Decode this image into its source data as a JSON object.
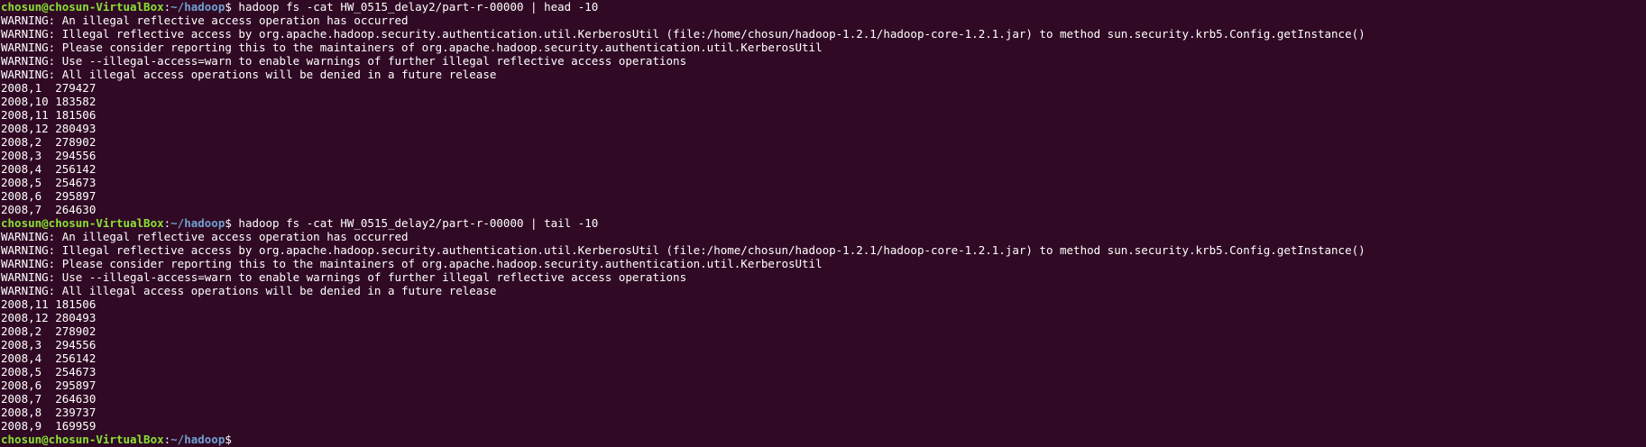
{
  "colors": {
    "background": "#300a24",
    "text": "#ffffff",
    "prompt_user": "#8ae234",
    "prompt_path": "#729fcf"
  },
  "prompt": {
    "user_host": "chosun@chosun-VirtualBox",
    "separator": ":",
    "path": "~/hadoop",
    "symbol": "$"
  },
  "blocks": [
    {
      "command": " hadoop fs -cat HW_0515_delay2/part-r-00000 | head -10",
      "output": [
        "WARNING: An illegal reflective access operation has occurred",
        "WARNING: Illegal reflective access by org.apache.hadoop.security.authentication.util.KerberosUtil (file:/home/chosun/hadoop-1.2.1/hadoop-core-1.2.1.jar) to method sun.security.krb5.Config.getInstance()",
        "WARNING: Please consider reporting this to the maintainers of org.apache.hadoop.security.authentication.util.KerberosUtil",
        "WARNING: Use --illegal-access=warn to enable warnings of further illegal reflective access operations",
        "WARNING: All illegal access operations will be denied in a future release",
        "2008,1  279427",
        "2008,10 183582",
        "2008,11 181506",
        "2008,12 280493",
        "2008,2  278902",
        "2008,3  294556",
        "2008,4  256142",
        "2008,5  254673",
        "2008,6  295897",
        "2008,7  264630"
      ]
    },
    {
      "command": " hadoop fs -cat HW_0515_delay2/part-r-00000 | tail -10",
      "output": [
        "WARNING: An illegal reflective access operation has occurred",
        "WARNING: Illegal reflective access by org.apache.hadoop.security.authentication.util.KerberosUtil (file:/home/chosun/hadoop-1.2.1/hadoop-core-1.2.1.jar) to method sun.security.krb5.Config.getInstance()",
        "WARNING: Please consider reporting this to the maintainers of org.apache.hadoop.security.authentication.util.KerberosUtil",
        "WARNING: Use --illegal-access=warn to enable warnings of further illegal reflective access operations",
        "WARNING: All illegal access operations will be denied in a future release",
        "2008,11 181506",
        "2008,12 280493",
        "2008,2  278902",
        "2008,3  294556",
        "2008,4  256142",
        "2008,5  254673",
        "2008,6  295897",
        "2008,7  264630",
        "2008,8  239737",
        "2008,9  169959"
      ]
    },
    {
      "command": "",
      "output": []
    }
  ]
}
